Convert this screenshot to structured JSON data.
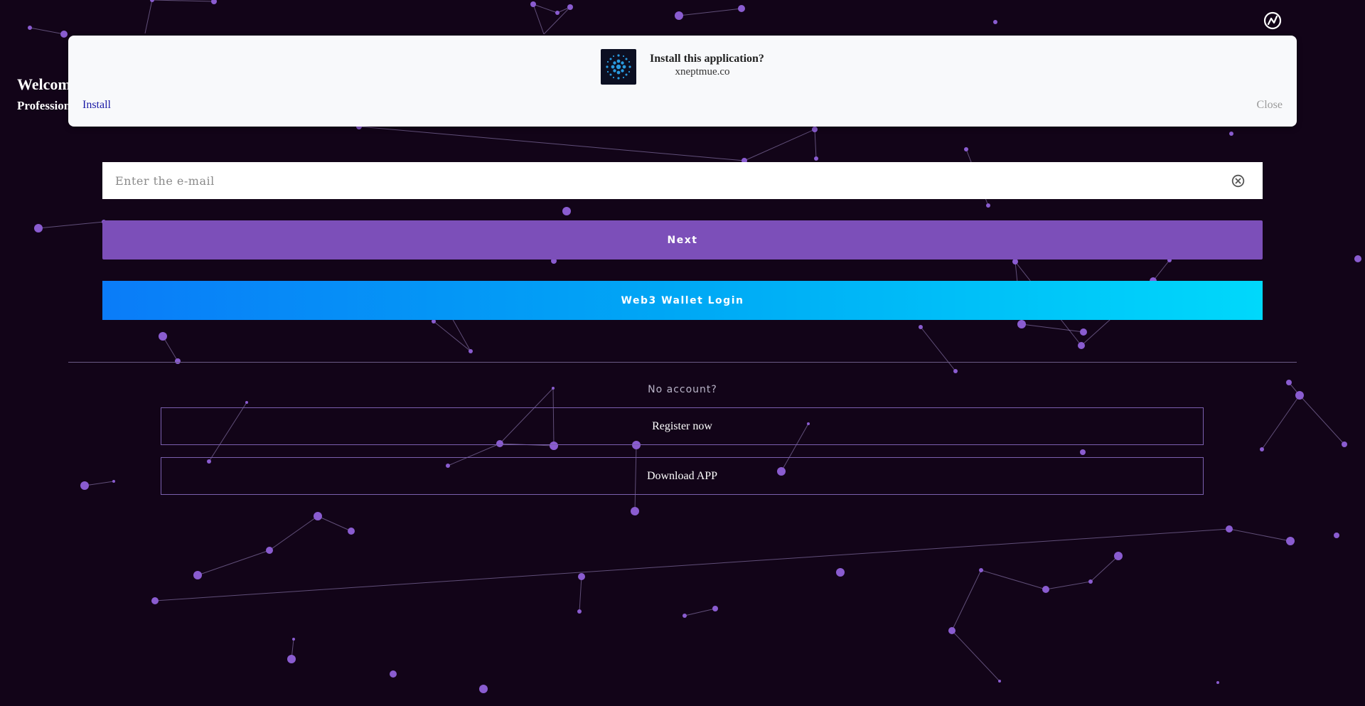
{
  "header": {
    "welcome_text": "Welcom",
    "subtitle_text": "Profession",
    "language_icon": "language-switch-icon"
  },
  "install_banner": {
    "title": "Install this application?",
    "domain": "xneptmue.co",
    "install_label": "Install",
    "close_label": "Close",
    "app_icon": "app-logo-icon"
  },
  "login": {
    "email_placeholder": "Enter the e-mail",
    "clear_icon": "clear-circle-x-icon",
    "next_label": "Next",
    "web3_label": "Web3 Wallet Login"
  },
  "signup": {
    "no_account_text": "No account?",
    "register_label": "Register now",
    "download_label": "Download APP"
  },
  "colors": {
    "background": "#120418",
    "accent_purple": "#7c4fb9",
    "web3_gradient_start": "#0a7cf8",
    "web3_gradient_end": "#00d8fb",
    "particle": "#8a5cd0"
  }
}
